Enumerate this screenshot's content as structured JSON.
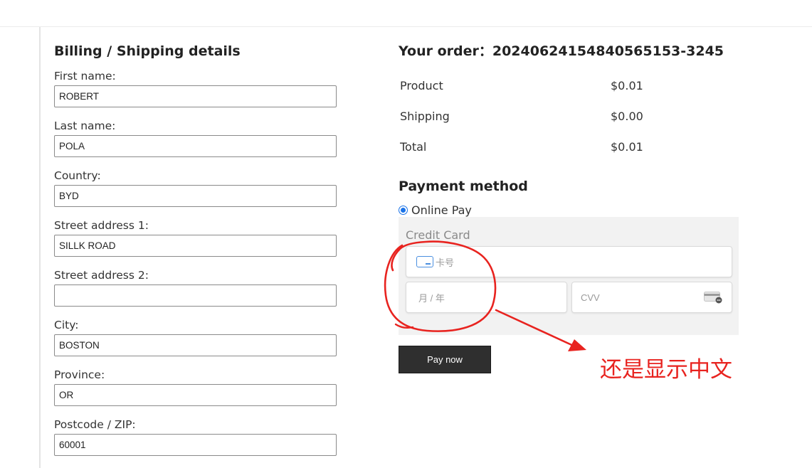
{
  "billing": {
    "title": "Billing / Shipping details",
    "fields": [
      {
        "label": "First name:",
        "value": "ROBERT"
      },
      {
        "label": "Last name:",
        "value": "POLA"
      },
      {
        "label": "Country:",
        "value": "BYD"
      },
      {
        "label": "Street address 1:",
        "value": "SILLK ROAD"
      },
      {
        "label": "Street address 2:",
        "value": ""
      },
      {
        "label": "City:",
        "value": "BOSTON"
      },
      {
        "label": "Province:",
        "value": "OR"
      },
      {
        "label": "Postcode / ZIP:",
        "value": "60001"
      }
    ]
  },
  "order": {
    "title": "Your order：20240624154840565153-3245",
    "rows": [
      {
        "label": "Product",
        "value": "$0.01"
      },
      {
        "label": "Shipping",
        "value": "$0.00"
      },
      {
        "label": "Total",
        "value": "$0.01"
      }
    ]
  },
  "payment": {
    "title": "Payment method",
    "option_label": "Online Pay",
    "option_selected": true,
    "card_title": "Credit Card",
    "card_number_placeholder": "卡号",
    "expiry_placeholder": "月 / 年",
    "cvv_placeholder": "CVV",
    "pay_button": "Pay now",
    "card_icon": "credit-card-icon",
    "cvv_icon": "cvv-card-icon"
  },
  "annotation": {
    "text": "还是显示中文",
    "color": "#e8231f"
  },
  "colors": {
    "accent": "#1a73e8",
    "button_bg": "#2f2f2f",
    "panel_bg": "#f2f2f2"
  }
}
